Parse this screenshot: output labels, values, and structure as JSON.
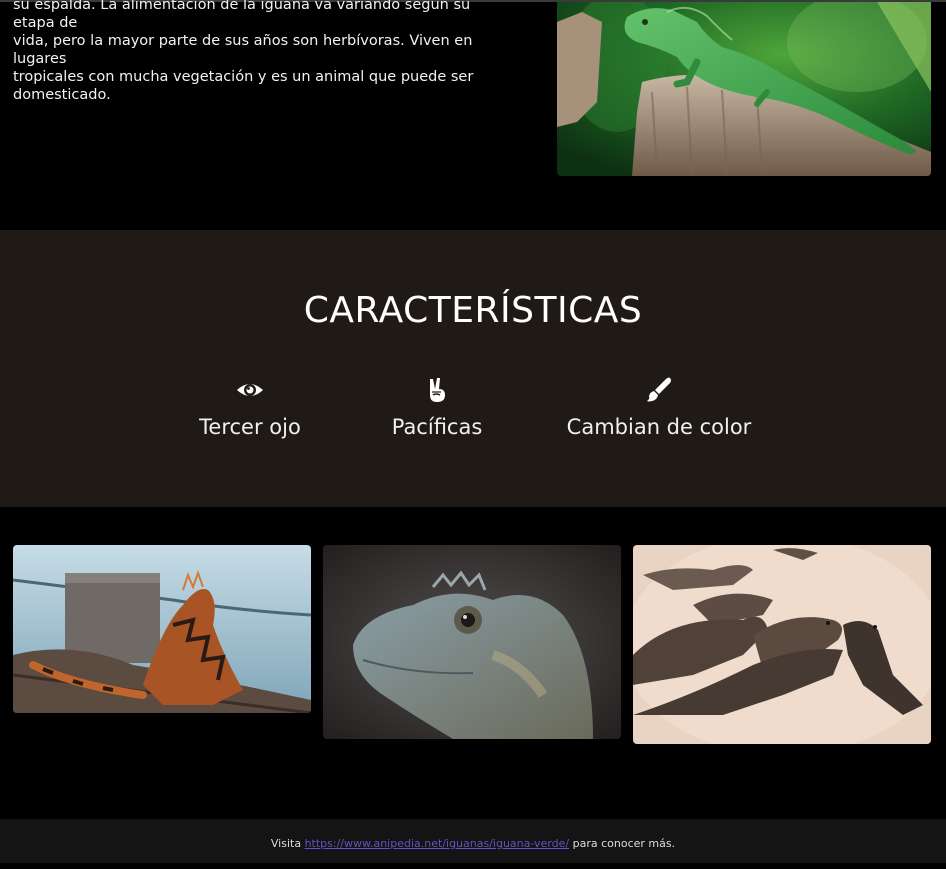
{
  "intro": {
    "text_line1": "su espalda. La alimentación de la iguana va variando según su etapa de",
    "text_line2": "vida, pero la mayor parte de sus años son herbívoras. Viven en lugares",
    "text_line3": "tropicales con mucha vegetación y es un animal que puede ser",
    "text_line4": "domesticado."
  },
  "characteristics": {
    "title": "CARACTERÍSTICAS",
    "items": [
      {
        "label": "Tercer ojo",
        "icon": "eye-icon"
      },
      {
        "label": "Pacíficas",
        "icon": "peace-hand-icon"
      },
      {
        "label": "Cambian de color",
        "icon": "paint-brush-icon"
      }
    ]
  },
  "footer": {
    "prefix": "Visita ",
    "link_text": "https://www.anipedia.net/iguanas/iguana-verde/",
    "suffix": " para conocer más."
  },
  "colors": {
    "background": "#000000",
    "section_bg": "#1f1a16",
    "footer_bg": "#141414",
    "link": "#6a4fc4"
  }
}
